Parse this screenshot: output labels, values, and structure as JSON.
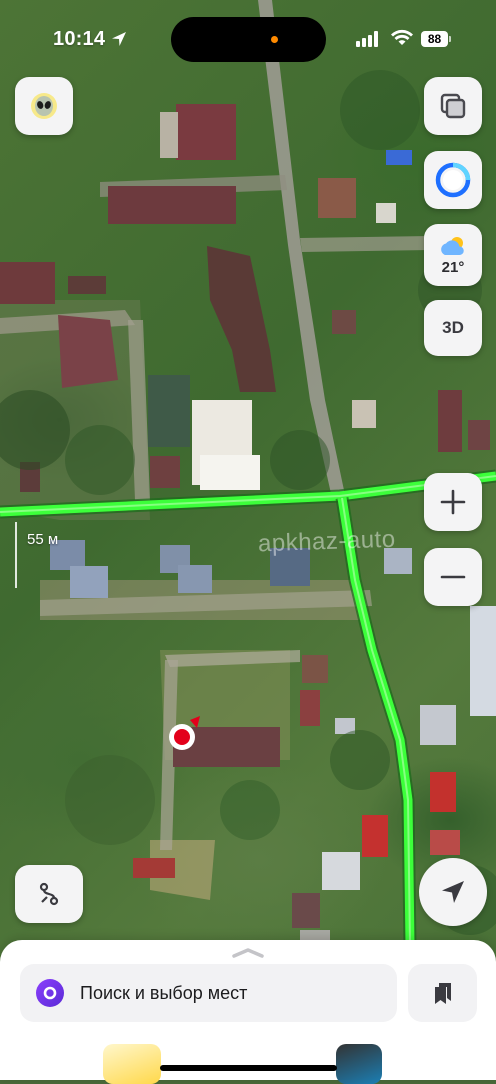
{
  "status_bar": {
    "time": "10:14",
    "battery": "88"
  },
  "map": {
    "scale_label": "55 м",
    "watermark": "apkhaz-auto",
    "route_color": "#3cff3a",
    "pin_color": "#e3001b",
    "view_mode": "satellite"
  },
  "controls": {
    "alien_icon": "alien-icon",
    "layers_icon": "layers-icon",
    "alice_icon": "alice-assistant-icon",
    "weather": {
      "icon": "partly-cloudy-icon",
      "temperature": "21°"
    },
    "three_d_label": "3D",
    "zoom_in_icon": "plus-icon",
    "zoom_out_icon": "minus-icon",
    "route_icon": "route-icon",
    "locate_icon": "navigation-arrow-icon"
  },
  "bottom_sheet": {
    "search_placeholder": "Поиск и выбор мест",
    "alice_button_icon": "alice-icon",
    "bookmarks_icon": "bookmarks-icon"
  },
  "colors": {
    "accent_purple": "#7b3cf2",
    "alice_blue": "#1e6fff"
  }
}
